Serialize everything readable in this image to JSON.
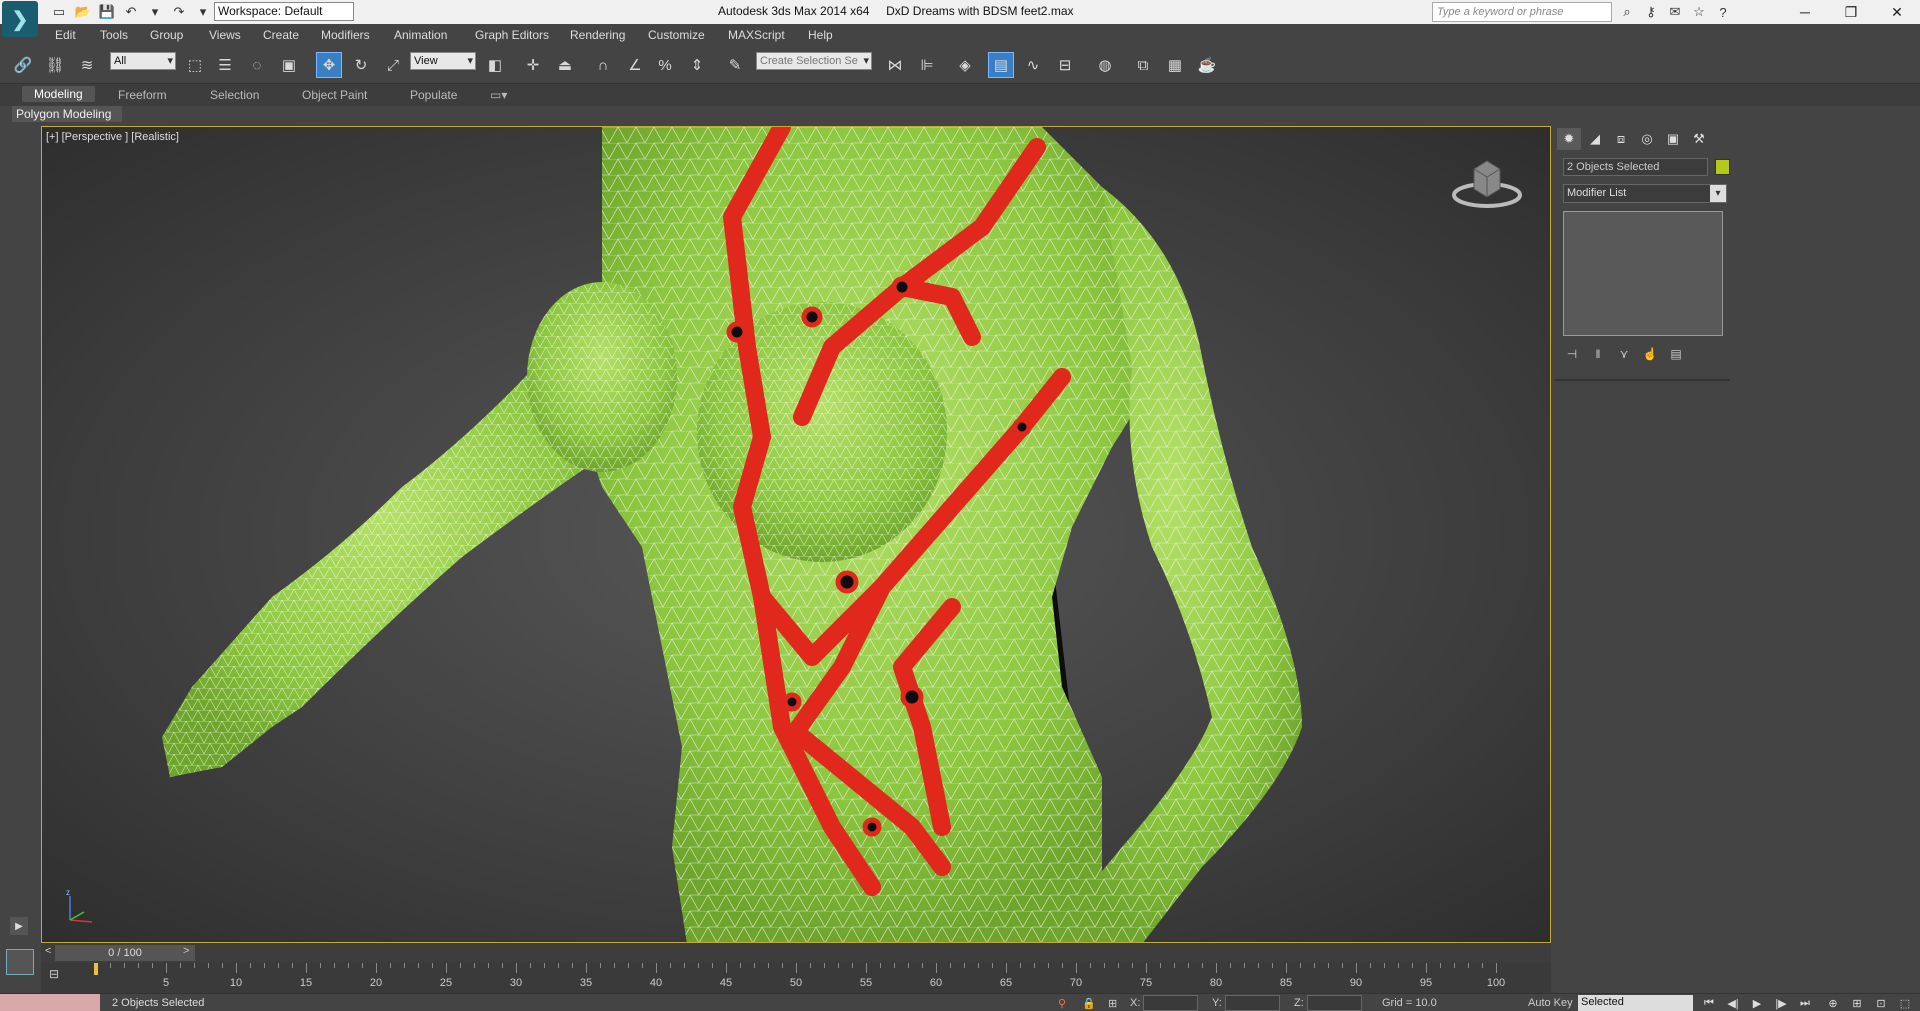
{
  "window": {
    "app_title": "Autodesk 3ds Max  2014 x64",
    "file_title": "DxD Dreams with BDSM feet2.max",
    "workspace_label": "Workspace: Default",
    "search_placeholder": "Type a keyword or phrase"
  },
  "menu": [
    "Edit",
    "Tools",
    "Group",
    "Views",
    "Create",
    "Modifiers",
    "Animation",
    "Graph Editors",
    "Rendering",
    "Customize",
    "MAXScript",
    "Help"
  ],
  "toolbar": {
    "selection_filter": "All",
    "reference_coord": "View",
    "named_selection_placeholder": "Create Selection Se"
  },
  "ribbon": {
    "tabs": [
      "Modeling",
      "Freeform",
      "Selection",
      "Object Paint",
      "Populate"
    ],
    "active_tab": "Modeling",
    "panel_label": "Polygon Modeling"
  },
  "viewport": {
    "label": "[+] [Perspective ] [Realistic]",
    "colors": {
      "skin": "#8cc63f",
      "harness": "#e0281c",
      "wire": "#ffffff",
      "frame": "#c8a833"
    }
  },
  "command_panel": {
    "object_name": "2 Objects Selected",
    "object_color": "#b5c81e",
    "modifier_list": "Modifier List"
  },
  "timeline": {
    "frame_display": "0 / 100",
    "prev_label": "<",
    "next_label": ">",
    "ticks": [
      "5",
      "10",
      "15",
      "20",
      "25",
      "30",
      "35",
      "40",
      "45",
      "50",
      "55",
      "60",
      "65",
      "70",
      "75",
      "80",
      "85",
      "90",
      "95",
      "100"
    ]
  },
  "status": {
    "selection_text": "2 Objects Selected",
    "x_label": "X:",
    "y_label": "Y:",
    "z_label": "Z:",
    "grid_text": "Grid = 10.0",
    "autokey_label": "Auto Key",
    "key_filter": "Selected"
  }
}
